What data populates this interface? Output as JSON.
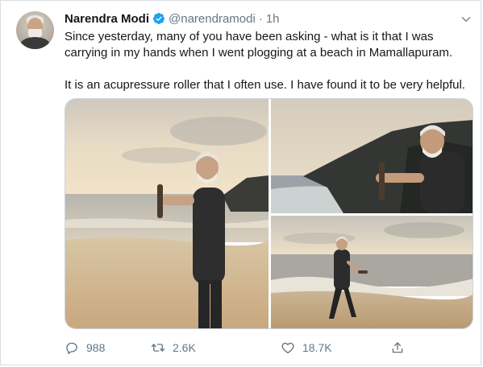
{
  "tweet": {
    "author_name": "Narendra Modi",
    "handle": "@narendramodi",
    "separator": "·",
    "time": "1h",
    "text_paragraphs": [
      "Since yesterday, many of you have been asking - what is it that I was carrying in my hands when I went plogging at a beach in Mamallapuram.",
      "It is an acupressure roller that I often use. I have found it to be very helpful."
    ]
  },
  "stats": {
    "replies": "988",
    "retweets": "2.6K",
    "likes": "18.7K"
  },
  "icons": {
    "verified": "verified-badge-icon",
    "menu": "chevron-down-icon",
    "reply": "reply-icon",
    "retweet": "retweet-icon",
    "like": "heart-icon",
    "share": "share-icon"
  },
  "colors": {
    "verified_blue": "#1da1f2",
    "muted_text": "#657786",
    "primary_text": "#14171a"
  }
}
